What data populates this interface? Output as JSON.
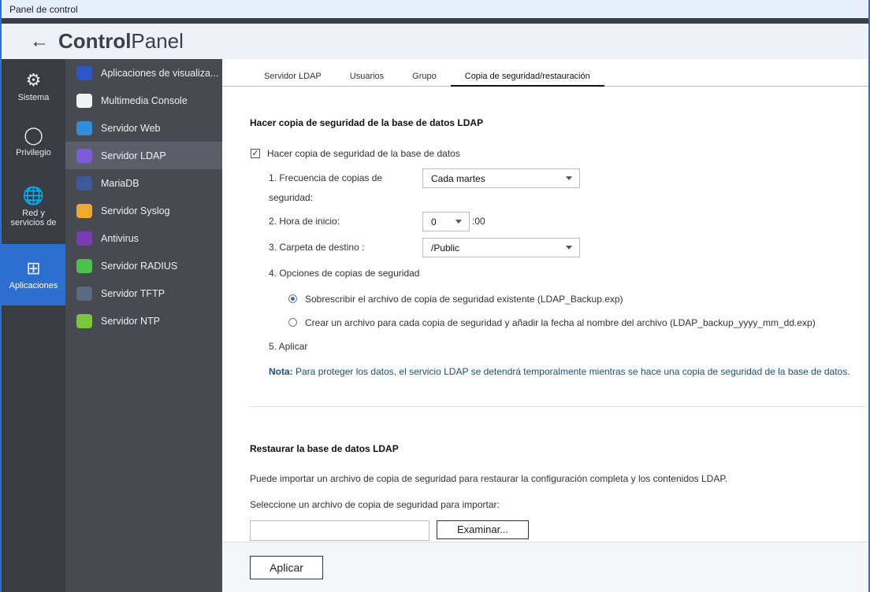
{
  "window": {
    "title": "Panel de control"
  },
  "header": {
    "title_bold": "Control",
    "title_light": "Panel"
  },
  "rail": [
    {
      "label": "Sistema",
      "icon": "gear-icon"
    },
    {
      "label": "Privilegio",
      "icon": "user-icon"
    },
    {
      "label": "Red y servicios de",
      "icon": "globe-icon"
    },
    {
      "label": "Aplicaciones",
      "icon": "apps-grid-icon",
      "active": true
    }
  ],
  "subnav": [
    {
      "label": "Aplicaciones de visualiza...",
      "color": "#2d55c8"
    },
    {
      "label": "Multimedia Console",
      "color": "#f2f2f2"
    },
    {
      "label": "Servidor Web",
      "color": "#2f8fd8"
    },
    {
      "label": "Servidor LDAP",
      "color": "#7d5ad6",
      "active": true
    },
    {
      "label": "MariaDB",
      "color": "#3c5a9a"
    },
    {
      "label": "Servidor Syslog",
      "color": "#f0a830"
    },
    {
      "label": "Antivirus",
      "color": "#7a3bb5"
    },
    {
      "label": "Servidor RADIUS",
      "color": "#4cc24c"
    },
    {
      "label": "Servidor TFTP",
      "color": "#5a6a80"
    },
    {
      "label": "Servidor NTP",
      "color": "#7cc63c"
    }
  ],
  "tabs": [
    "Servidor LDAP",
    "Usuarios",
    "Grupo",
    "Copia de seguridad/restauración"
  ],
  "backup": {
    "title": "Hacer copia de seguridad de la base de datos LDAP",
    "enable_label": "Hacer copia de seguridad de la base de datos",
    "enabled": true,
    "freq_label_1": "1. Frecuencia de copias de",
    "freq_label_2": "seguridad:",
    "freq_value": "Cada martes",
    "hour_label": "2. Hora de inicio:",
    "hour_value": "0",
    "hour_suffix": ":00",
    "folder_label": "3. Carpeta de destino :",
    "folder_value": "/Public",
    "options_label": "4. Opciones de copias de seguridad",
    "option_1": "Sobrescribir el archivo de copia de seguridad existente (LDAP_Backup.exp)",
    "option_2": "Crear un archivo para cada copia de seguridad y añadir la fecha al nombre del archivo (LDAP_backup_yyyy_mm_dd.exp)",
    "apply_label": "5. Aplicar",
    "note_label": "Nota:",
    "note_text": " Para proteger los datos, el servicio LDAP se detendrá temporalmente mientras se hace una copia de seguridad de la base de datos."
  },
  "restore": {
    "title": "Restaurar la base de datos LDAP",
    "description": "Puede importar un archivo de copia de seguridad para restaurar la configuración completa y los contenidos LDAP.",
    "select_label": "Seleccione un archivo de copia de seguridad para importar:",
    "file_value": "",
    "browse_label": "Examinar..."
  },
  "footer": {
    "apply_button": "Aplicar"
  }
}
